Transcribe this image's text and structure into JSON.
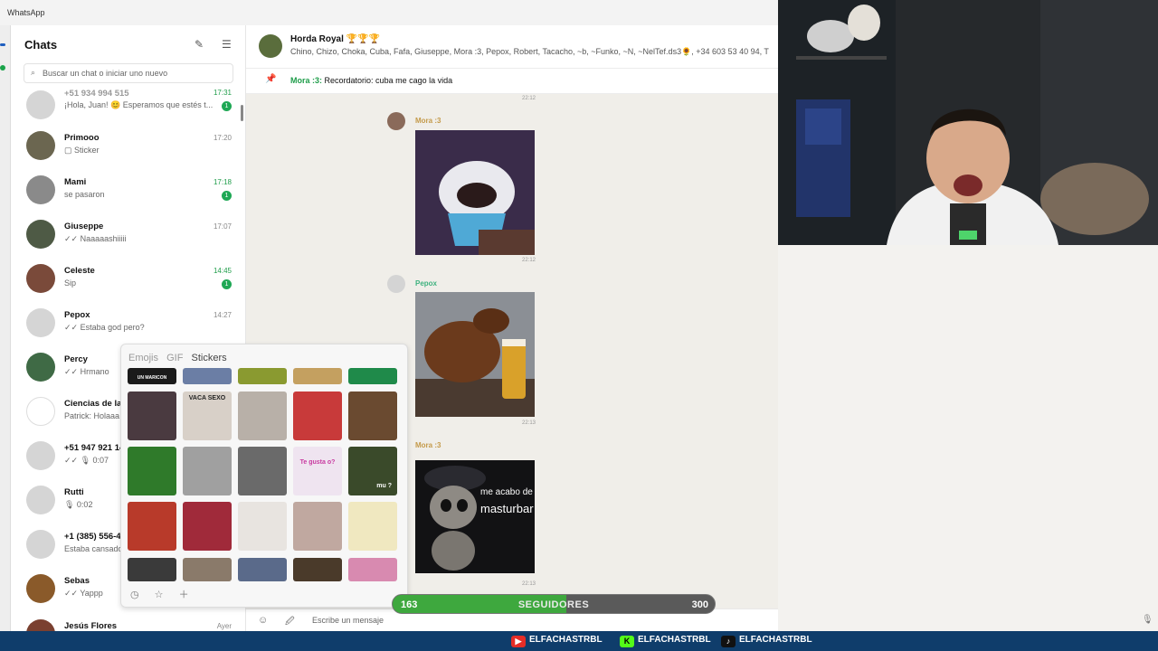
{
  "app": {
    "title": "WhatsApp"
  },
  "sidebar": {
    "title": "Chats",
    "search_placeholder": "Buscar un chat o iniciar uno nuevo",
    "chats": [
      {
        "name": "+51 934 994 515",
        "preview": "¡Hola, Juan! 😊 Esperamos que estés t...",
        "time": "17:31",
        "unread": "1"
      },
      {
        "name": "Primooo",
        "preview": "Sticker",
        "time": "17:20",
        "unread": ""
      },
      {
        "name": "Mami",
        "preview": "se pasaron",
        "time": "17:18",
        "unread": "1"
      },
      {
        "name": "Giuseppe",
        "preview": "✓✓ Naaaaashiiiii",
        "time": "17:07",
        "unread": ""
      },
      {
        "name": "Celeste",
        "preview": "Sip",
        "time": "14:45",
        "unread": "1"
      },
      {
        "name": "Pepox",
        "preview": "✓✓ Estaba god pero?",
        "time": "14:27",
        "unread": ""
      },
      {
        "name": "Percy",
        "preview": "✓✓ Hrmano",
        "time": "",
        "unread": ""
      },
      {
        "name": "Ciencias de la C",
        "preview": "Patrick: Holaaa",
        "time": "",
        "unread": ""
      },
      {
        "name": "+51 947 921 14",
        "preview": "✓✓ 🎙 0:07",
        "time": "",
        "unread": ""
      },
      {
        "name": "Rutti",
        "preview": "🎙 0:02",
        "time": "",
        "unread": ""
      },
      {
        "name": "+1 (385) 556-4",
        "preview": "Estaba cansado",
        "time": "",
        "unread": ""
      },
      {
        "name": "Sebas",
        "preview": "✓✓ Yappp",
        "time": "",
        "unread": ""
      },
      {
        "name": "Jesús Flores",
        "preview": "",
        "time": "Ayer",
        "unread": ""
      }
    ]
  },
  "chat": {
    "group_name": "Horda Royal 🏆🏆🏆",
    "members": "Chino, Chizo, Choka, Cuba, Fafa, Giuseppe, Mora :3, Pepox, Robert, Tacacho, ~b, ~Funko, ~N, ~NelTef.ds3🌻, +34 603 53 40 94, T",
    "pinned_author": "Mora :3:",
    "pinned_text": "Recordatorio: cuba me cago la vida",
    "messages": [
      {
        "sender": "",
        "time": "22:12"
      },
      {
        "sender": "Mora :3",
        "time": "22:12"
      },
      {
        "sender": "Pepox",
        "time": "22:13"
      },
      {
        "sender": "Mora :3",
        "time": "22:13"
      }
    ],
    "sticker3_caption_line1": "me acabo de",
    "sticker3_caption_line2": "masturbar",
    "composer_placeholder": "Escribe un mensaje"
  },
  "sticker_picker": {
    "tabs": [
      "Emojis",
      "GIF",
      "Stickers"
    ],
    "active_tab": "Stickers",
    "captions": {
      "r0c0": "UN MARICON",
      "r1c1": "VACA SEXO",
      "r2c3": "Te gusta o?",
      "r2c4": "mu ?"
    },
    "footer_icons": [
      "recent-icon",
      "star-icon",
      "plus-icon"
    ]
  },
  "overlay": {
    "followers_current": "163",
    "followers_label": "SEGUIDORES",
    "followers_goal": "300",
    "followers_progress": 0.54,
    "socials": [
      {
        "platform": "YouTube",
        "handle": "ELFACHASTRBL",
        "color": "#e52d27"
      },
      {
        "platform": "Kick",
        "handle": "ELFACHASTRBL",
        "color": "#53fc18"
      },
      {
        "platform": "TikTok",
        "handle": "ELFACHASTRBL",
        "color": "#111111"
      }
    ]
  },
  "colors": {
    "accent": "#1f9d4a",
    "follower_fill": "#3ea83e",
    "taskbar": "#0f3d6b",
    "sender_mora": "#c49a4a",
    "sender_pepox": "#3fb27f"
  }
}
